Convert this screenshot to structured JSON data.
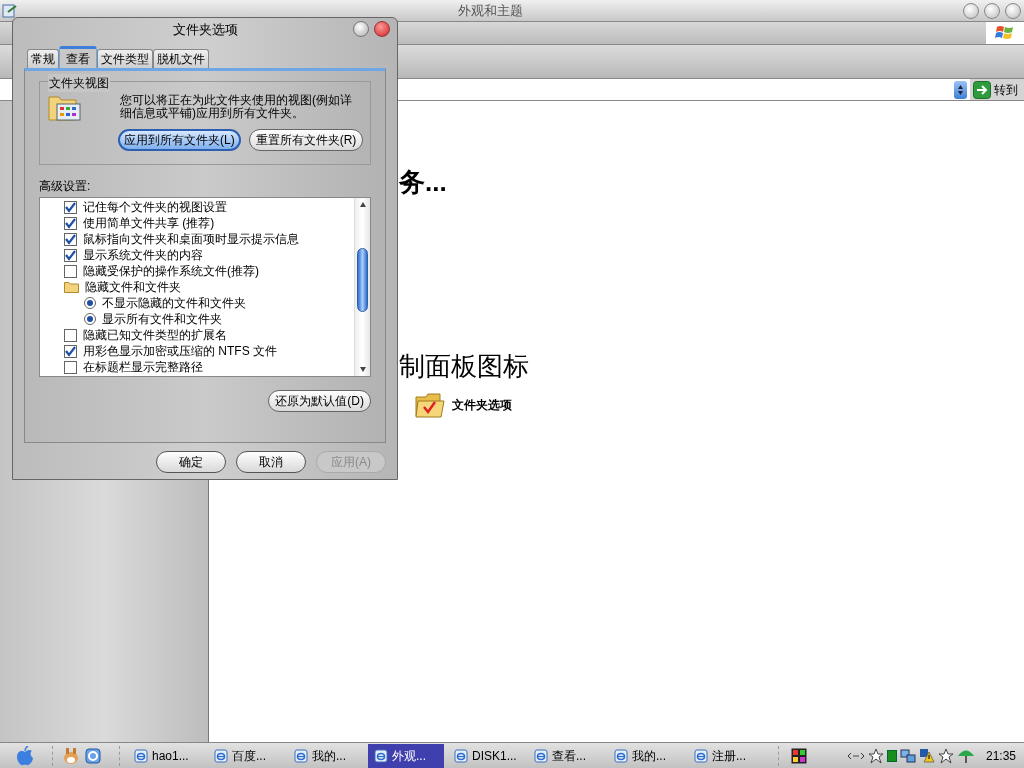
{
  "main_window": {
    "title": "外观和主题",
    "go_button": "转到",
    "heading_1": "务...",
    "heading_2": "制面板图标",
    "items": [
      {
        "label": "文件夹选项"
      }
    ]
  },
  "dialog": {
    "title": "文件夹选项",
    "tabs": [
      {
        "label": "常规",
        "selected": false
      },
      {
        "label": "查看",
        "selected": true
      },
      {
        "label": "文件类型",
        "selected": false
      },
      {
        "label": "脱机文件",
        "selected": false
      }
    ],
    "folder_views": {
      "legend": "文件夹视图",
      "description": "您可以将正在为此文件夹使用的视图(例如详细信息或平铺)应用到所有文件夹。",
      "buttons": [
        {
          "label": "应用到所有文件夹(L)",
          "focused": true
        },
        {
          "label": "重置所有文件夹(R)",
          "focused": false
        }
      ]
    },
    "advanced": {
      "label": "高级设置:",
      "items": [
        {
          "kind": "checkbox",
          "label": "记住每个文件夹的视图设置",
          "checked": true
        },
        {
          "kind": "checkbox",
          "label": "使用简单文件共享 (推荐)",
          "checked": true
        },
        {
          "kind": "checkbox",
          "label": "鼠标指向文件夹和桌面项时显示提示信息",
          "checked": true
        },
        {
          "kind": "checkbox",
          "label": "显示系统文件夹的内容",
          "checked": true
        },
        {
          "kind": "checkbox",
          "label": "隐藏受保护的操作系统文件(推荐)",
          "checked": false
        },
        {
          "kind": "group",
          "label": "隐藏文件和文件夹",
          "children": [
            {
              "kind": "radio",
              "label": "不显示隐藏的文件和文件夹",
              "checked": true
            },
            {
              "kind": "radio",
              "label": "显示所有文件和文件夹",
              "checked": true
            }
          ]
        },
        {
          "kind": "checkbox",
          "label": "隐藏已知文件类型的扩展名",
          "checked": false
        },
        {
          "kind": "checkbox",
          "label": "用彩色显示加密或压缩的 NTFS 文件",
          "checked": true
        },
        {
          "kind": "checkbox",
          "label": "在标题栏显示完整路径",
          "checked": false
        }
      ]
    },
    "restore_button": "还原为默认值(D)",
    "buttons": [
      {
        "label": "确定",
        "disabled": false
      },
      {
        "label": "取消",
        "disabled": false
      },
      {
        "label": "应用(A)",
        "disabled": true
      }
    ]
  },
  "taskbar": {
    "tasks": [
      {
        "label": "hao1...",
        "selected": false
      },
      {
        "label": "百度...",
        "selected": false
      },
      {
        "label": "我的...",
        "selected": false
      },
      {
        "label": "外观...",
        "selected": true
      },
      {
        "label": "DISK1...",
        "selected": false
      },
      {
        "label": "查看...",
        "selected": false
      },
      {
        "label": "我的...",
        "selected": false
      },
      {
        "label": "注册...",
        "selected": false
      }
    ],
    "clock": "21:35"
  }
}
